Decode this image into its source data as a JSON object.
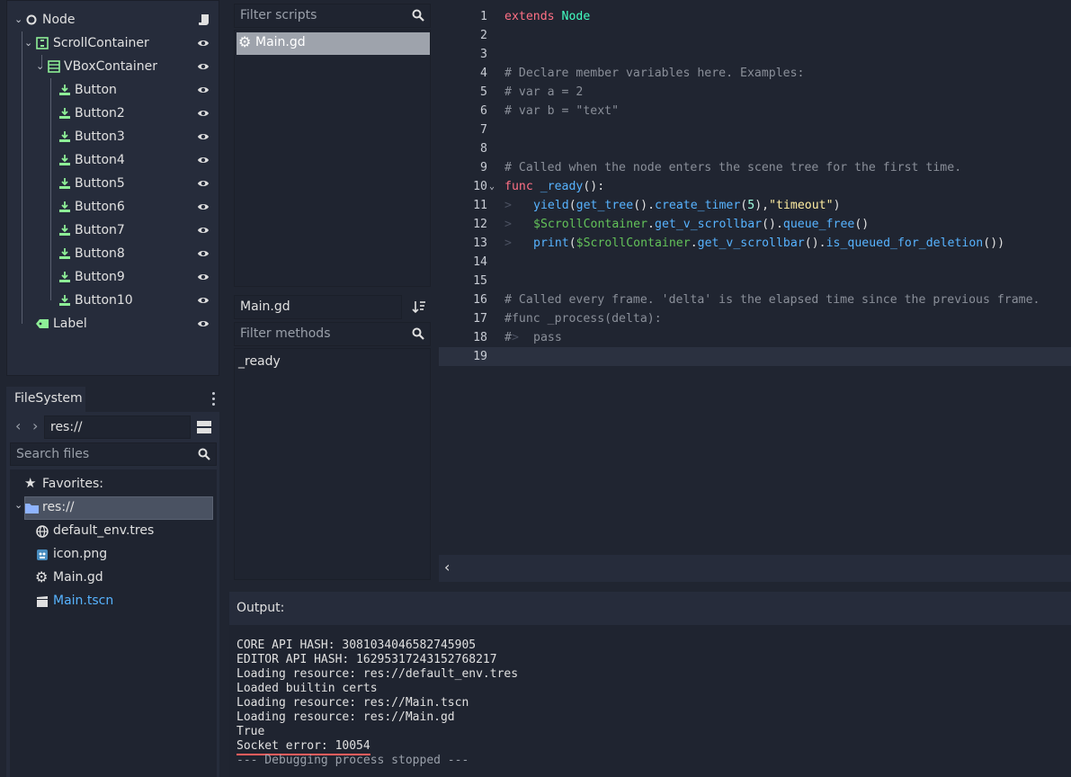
{
  "scene_tree": {
    "root": "Node",
    "items": [
      {
        "label": "ScrollContainer"
      },
      {
        "label": "VBoxContainer"
      },
      {
        "label": "Button"
      },
      {
        "label": "Button2"
      },
      {
        "label": "Button3"
      },
      {
        "label": "Button4"
      },
      {
        "label": "Button5"
      },
      {
        "label": "Button6"
      },
      {
        "label": "Button7"
      },
      {
        "label": "Button8"
      },
      {
        "label": "Button9"
      },
      {
        "label": "Button10"
      },
      {
        "label": "Label"
      }
    ]
  },
  "filesystem": {
    "tab_label": "FileSystem",
    "path": "res://",
    "search_placeholder": "Search files",
    "favorites_label": "Favorites:",
    "root_folder": "res://",
    "files": [
      {
        "name": "default_env.tres",
        "icon": "globe-icon"
      },
      {
        "name": "icon.png",
        "icon": "image-icon"
      },
      {
        "name": "Main.gd",
        "icon": "gear-icon"
      },
      {
        "name": "Main.tscn",
        "icon": "clapper-icon"
      }
    ]
  },
  "scripts": {
    "filter_placeholder": "Filter scripts",
    "list": [
      "Main.gd"
    ],
    "current_name": "Main.gd",
    "methods_placeholder": "Filter methods",
    "methods": [
      "_ready"
    ]
  },
  "editor": {
    "line_numbers": [
      "1",
      "2",
      "3",
      "4",
      "5",
      "6",
      "7",
      "8",
      "9",
      "10",
      "11",
      "12",
      "13",
      "14",
      "15",
      "16",
      "17",
      "18",
      "19"
    ],
    "l1_kw": "extends",
    "l1_cls": "Node",
    "l4": "# Declare member variables here. Examples:",
    "l5": "# var a = 2",
    "l6": "# var b = \"text\"",
    "l9": "# Called when the node enters the scene tree for the first time.",
    "l10_kw": "func",
    "l10_fn": "_ready",
    "l10_rest": "():",
    "l11_fn1": "yield",
    "l11_fn2": "get_tree",
    "l11_fn3": "create_timer",
    "l11_num": "5",
    "l11_str": "\"timeout\"",
    "l12_node": "$ScrollContainer",
    "l12_fn1": "get_v_scrollbar",
    "l12_fn2": "queue_free",
    "l13_fn1": "print",
    "l13_node": "$ScrollContainer",
    "l13_fn2": "get_v_scrollbar",
    "l13_fn3": "is_queued_for_deletion",
    "l16": "# Called every frame. 'delta' is the elapsed time since the previous frame.",
    "l17": "#func _process(delta):",
    "l18_hash": "#",
    "l18_rest": "pass"
  },
  "output": {
    "title": "Output:",
    "lines": [
      "CORE API HASH: 3081034046582745905",
      "EDITOR API HASH: 1629531724315276821​7",
      "Loading resource: res://default_env.tres",
      "Loaded builtin certs",
      "Loading resource: res://Main.tscn",
      "Loading resource: res://Main.gd",
      "True",
      "Socket error: 10054",
      "--- Debugging process stopped ---"
    ]
  },
  "colors": {
    "accent_blue": "#57b3ff",
    "node_green": "#8eef97",
    "error_red": "#ff5d5d"
  }
}
